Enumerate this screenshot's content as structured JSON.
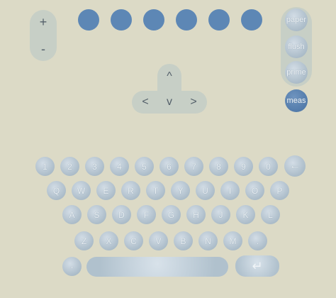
{
  "zoom": {
    "plus": "+",
    "minus": "-"
  },
  "indicators": {
    "count": 6,
    "color": "#5d87b5"
  },
  "side_buttons": [
    {
      "label": "paper",
      "active": false
    },
    {
      "label": "flush",
      "active": false
    },
    {
      "label": "prime",
      "active": false
    },
    {
      "label": "meas",
      "active": true
    }
  ],
  "dpad": {
    "up": "^",
    "left": "<",
    "down": "v",
    "right": ">"
  },
  "keyboard": {
    "row1": [
      "1",
      "2",
      "3",
      "4",
      "5",
      "6",
      "7",
      "8",
      "9",
      "0",
      "←"
    ],
    "row2": [
      "Q",
      "W",
      "E",
      "R",
      "T",
      "Y",
      "U",
      "I",
      "O",
      "P"
    ],
    "row3": [
      "A",
      "S",
      "D",
      "F",
      "G",
      "H",
      "J",
      "K",
      "L"
    ],
    "row4": [
      "Z",
      "X",
      "C",
      "V",
      "B",
      "N",
      "M",
      "."
    ],
    "row5": [
      "-"
    ],
    "enter": "↵"
  },
  "colors": {
    "background": "#dcdac6",
    "key": "#a9bac7",
    "accent": "#4f78a8",
    "panel": "#c7cfc6"
  }
}
